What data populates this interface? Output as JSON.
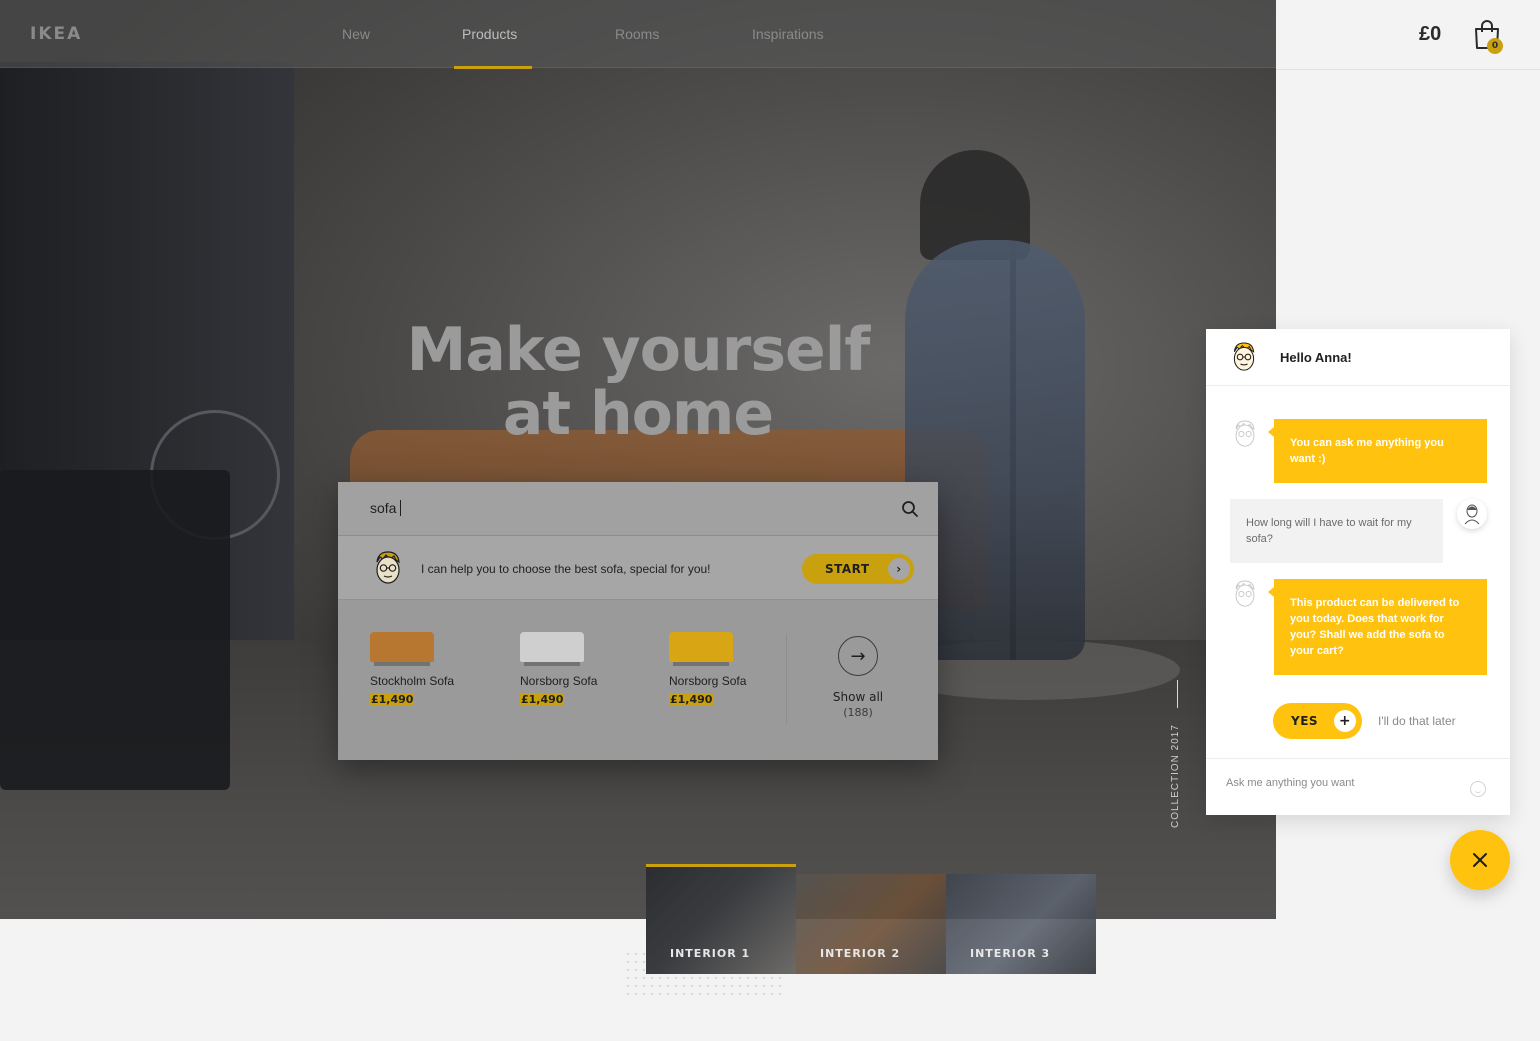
{
  "brand": {
    "logo": "IKEA"
  },
  "nav": {
    "items": [
      {
        "label": "New",
        "active": false
      },
      {
        "label": "Products",
        "active": true
      },
      {
        "label": "Rooms",
        "active": false
      },
      {
        "label": "Inspirations",
        "active": false
      }
    ]
  },
  "cart": {
    "total": "£0",
    "count": "0"
  },
  "hero": {
    "headline_line1": "Make yourself",
    "headline_line2": "at home",
    "collection": "COLLECTION 2017"
  },
  "search": {
    "value": "sofa",
    "assistant_text": "I can help you to choose the best sofa, special for you!",
    "start_label": "START",
    "products": [
      {
        "name": "Stockholm Sofa",
        "price": "£1,490",
        "color": "#b77730"
      },
      {
        "name": "Norsborg Sofa",
        "price": "£1,490",
        "color": "#cfcfcf"
      },
      {
        "name": "Norsborg Sofa",
        "price": "£1,490",
        "color": "#d8a514"
      }
    ],
    "show_all_label": "Show all",
    "show_all_count": "(188)"
  },
  "interiors": [
    {
      "label": "INTERIOR 1",
      "active": true
    },
    {
      "label": "INTERIOR 2",
      "active": false
    },
    {
      "label": "INTERIOR 3",
      "active": false
    }
  ],
  "chat": {
    "greeting": "Hello Anna!",
    "messages": [
      {
        "from": "bot",
        "text": "You can ask me anything you want :)"
      },
      {
        "from": "user",
        "text": "How long will I have to wait for my sofa?"
      },
      {
        "from": "bot",
        "text": "This product can be delivered to you today. Does that work for you? Shall we add the sofa to your cart?"
      }
    ],
    "yes_label": "YES",
    "later_label": "I'll do that later",
    "input_placeholder": "Ask me anything you want"
  },
  "colors": {
    "accent": "#ffc20e",
    "accent_dim": "#c9a00d",
    "text": "#1f1f1f"
  }
}
